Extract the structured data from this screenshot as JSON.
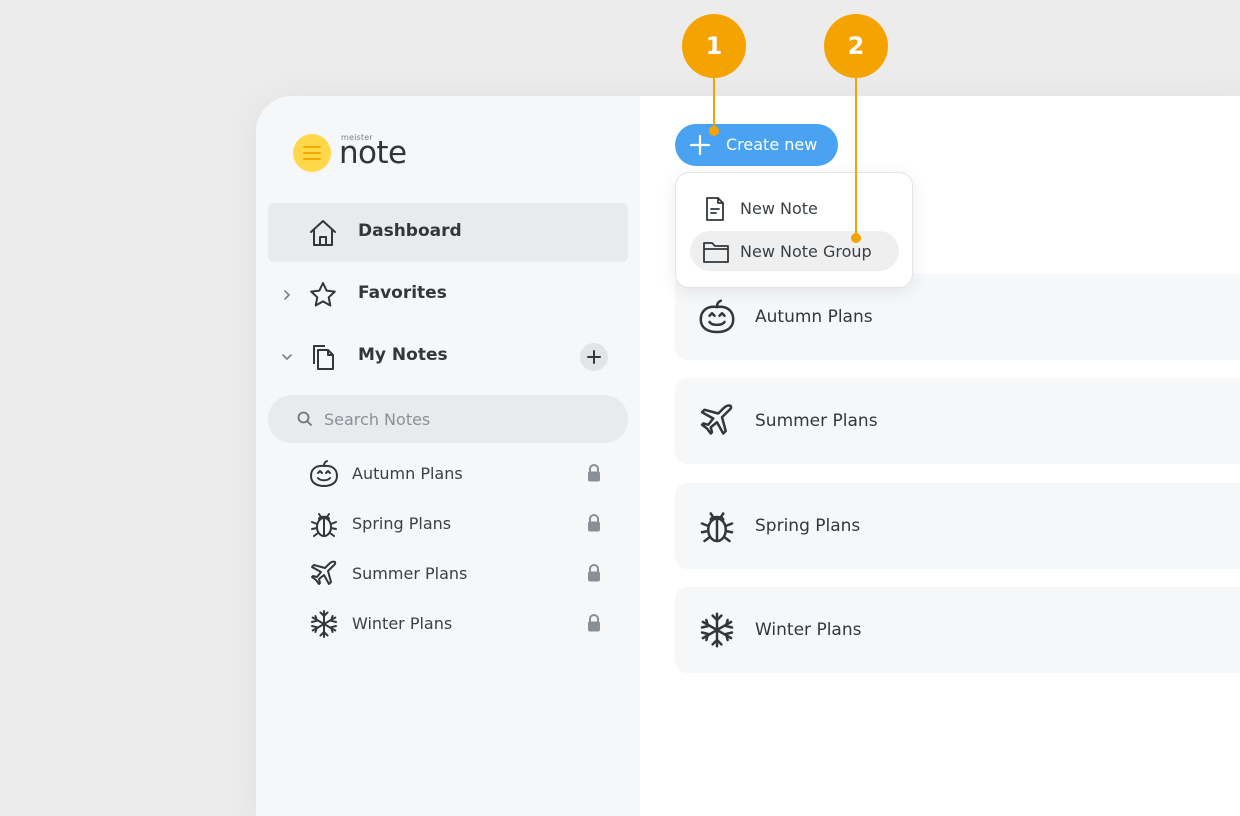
{
  "logo": {
    "brand_small": "meister",
    "brand_main": "note"
  },
  "sidebar": {
    "nav": [
      {
        "label": "Dashboard",
        "icon": "home-icon",
        "active": true
      },
      {
        "label": "Favorites",
        "icon": "star-icon",
        "expanded": false
      },
      {
        "label": "My Notes",
        "icon": "notes-copy-icon",
        "expanded": true
      }
    ],
    "search": {
      "placeholder": "Search Notes"
    },
    "notes": [
      {
        "label": "Autumn Plans",
        "icon": "pumpkin-icon",
        "locked": true
      },
      {
        "label": "Spring Plans",
        "icon": "bug-icon",
        "locked": true
      },
      {
        "label": "Summer Plans",
        "icon": "airplane-icon",
        "locked": true
      },
      {
        "label": "Winter Plans",
        "icon": "snowflake-icon",
        "locked": true
      }
    ]
  },
  "main": {
    "create_button": {
      "label": "Create new"
    },
    "create_menu": [
      {
        "label": "New Note",
        "icon": "document-icon"
      },
      {
        "label": "New Note Group",
        "icon": "folder-icon",
        "hovered": true
      }
    ],
    "cards": [
      {
        "label": "Autumn Plans",
        "icon": "pumpkin-icon"
      },
      {
        "label": "Summer Plans",
        "icon": "airplane-icon"
      },
      {
        "label": "Spring Plans",
        "icon": "bug-icon"
      },
      {
        "label": "Winter Plans",
        "icon": "snowflake-icon"
      }
    ]
  },
  "callouts": [
    {
      "number": "1"
    },
    {
      "number": "2"
    }
  ],
  "colors": {
    "background": "#ececec",
    "sidebar": "#f6f7f9",
    "accent_blue": "#4aa3f2",
    "callout_orange": "#f5a300",
    "logo_yellow": "#ffd84a"
  }
}
